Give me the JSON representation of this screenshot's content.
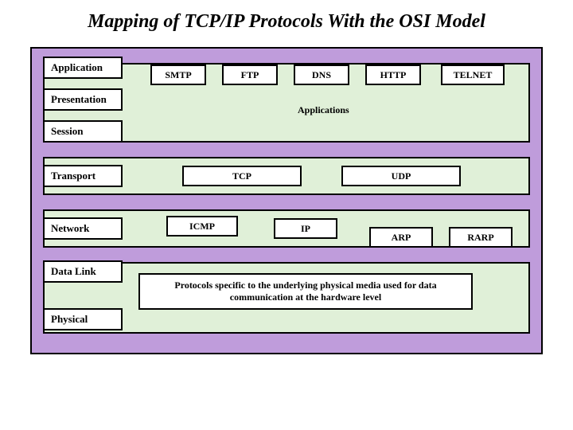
{
  "title": "Mapping of TCP/IP Protocols With the OSI Model",
  "osi": {
    "application": "Application",
    "presentation": "Presentation",
    "session": "Session",
    "transport": "Transport",
    "network": "Network",
    "datalink": "Data Link",
    "physical": "Physical"
  },
  "app_layer": {
    "smtp": "SMTP",
    "ftp": "FTP",
    "dns": "DNS",
    "http": "HTTP",
    "telnet": "TELNET",
    "label": "Applications"
  },
  "transport_layer": {
    "tcp": "TCP",
    "udp": "UDP"
  },
  "network_layer": {
    "icmp": "ICMP",
    "ip": "IP",
    "arp": "ARP",
    "rarp": "RARP"
  },
  "physical_note": "Protocols specific to the underlying physical media used for data communication at the hardware level"
}
